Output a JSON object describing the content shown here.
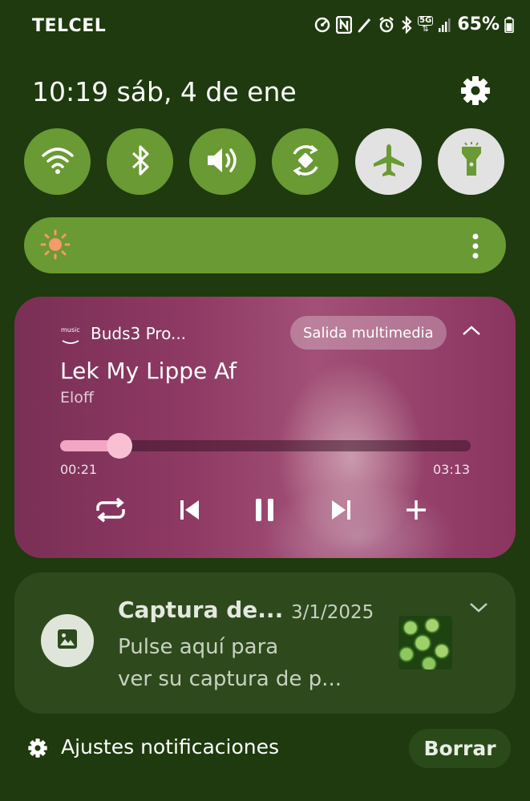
{
  "status_bar": {
    "carrier": "TELCEL",
    "network": "5G",
    "battery": "65%"
  },
  "header": {
    "datetime": "10:19 sáb, 4 de ene"
  },
  "quick_toggles": [
    {
      "name": "wifi",
      "state": "on"
    },
    {
      "name": "bluetooth",
      "state": "on"
    },
    {
      "name": "sound",
      "state": "on"
    },
    {
      "name": "auto-rotate",
      "state": "on"
    },
    {
      "name": "airplane-mode",
      "state": "off"
    },
    {
      "name": "flashlight",
      "state": "off"
    }
  ],
  "brightness": {
    "level": 0.0
  },
  "media": {
    "device": "Buds3 Pro...",
    "output_button": "Salida multimedia",
    "song": "Lek My Lippe Af",
    "artist": "Eloff",
    "elapsed": "00:21",
    "total": "03:13",
    "progress": 0.109,
    "app_icon_text": "music"
  },
  "notification": {
    "title": "Captura de...",
    "date": "3/1/2025",
    "body_line1": "Pulse aquí para",
    "body_line2": "ver su captura de p..."
  },
  "footer": {
    "settings_label": "Ajustes notificaciones",
    "clear_label": "Borrar"
  },
  "colors": {
    "background": "#1e3a0e",
    "toggle_on": "#6a9a33",
    "toggle_off": "#e2e2e2",
    "sun": "#f59a6a",
    "progress_fill": "#f2a6c3",
    "notification_bg": "#2e4a1d"
  }
}
